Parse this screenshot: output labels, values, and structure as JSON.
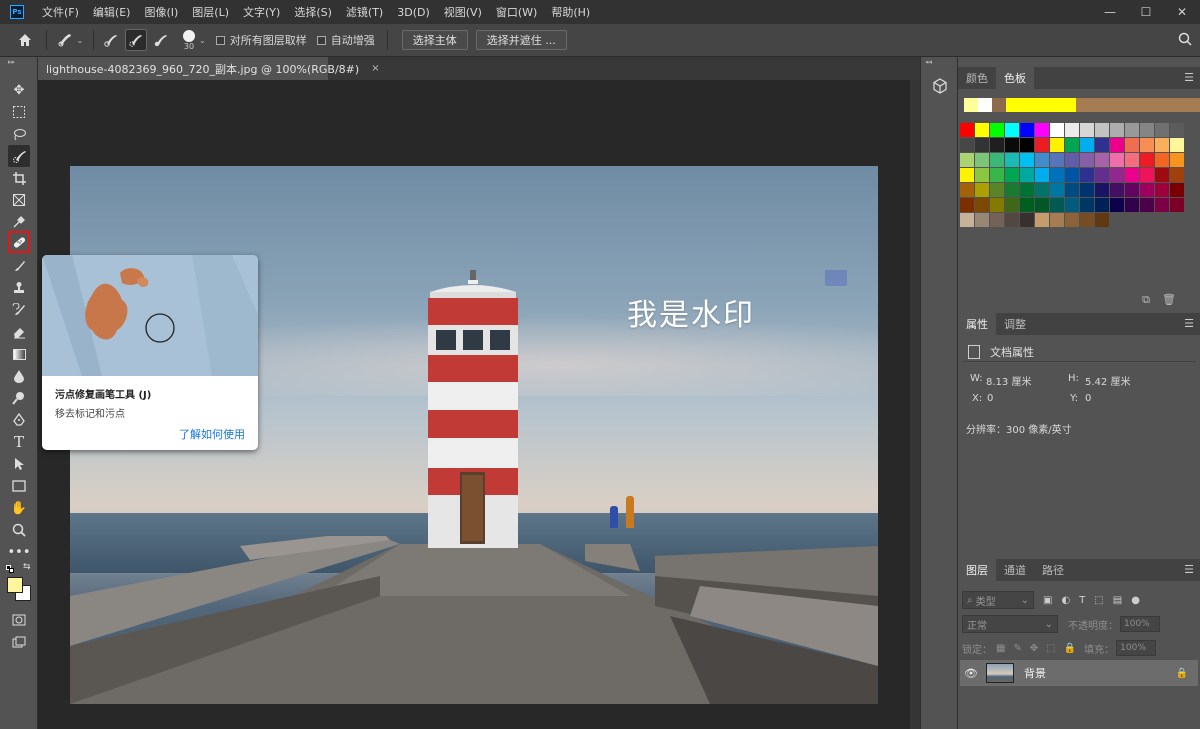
{
  "app": {
    "logo": "Ps"
  },
  "menu": [
    "文件(F)",
    "编辑(E)",
    "图像(I)",
    "图层(L)",
    "文字(Y)",
    "选择(S)",
    "滤镜(T)",
    "3D(D)",
    "视图(V)",
    "窗口(W)",
    "帮助(H)"
  ],
  "window_controls": {
    "minimize": "—",
    "maximize": "☐",
    "close": "✕"
  },
  "options": {
    "brush_size": "30",
    "sample_all_layers": "对所有图层取样",
    "auto_enhance": "自动增强",
    "select_subject": "选择主体",
    "select_and_mask": "选择并遮住 ..."
  },
  "document": {
    "tab_title": "lighthouse-4082369_960_720_副本.jpg @ 100%(RGB/8#)",
    "close": "×"
  },
  "image": {
    "watermark": "我是水印"
  },
  "tooltip": {
    "title": "污点修复画笔工具 (J)",
    "description": "移去标记和污点",
    "link": "了解如何使用"
  },
  "swatches_panel": {
    "tabs": [
      "颜色",
      "色板"
    ],
    "active_tab": 1,
    "recent": [
      "#ffff99",
      "#ffffff",
      "#8c6a4a",
      "#ffff00",
      "#ffff00",
      "#ffff00",
      "#ffff00",
      "#ffff00",
      "#a67c52",
      "#a67c52",
      "#a67c52",
      "#a67c52",
      "#a67c52",
      "#a67c52",
      "#a67c52",
      "#a67c52",
      "#a67c52",
      "#a67c52"
    ],
    "grid": [
      "#ff0000",
      "#ffff00",
      "#00ff00",
      "#00ffff",
      "#0000ff",
      "#ff00ff",
      "#ffffff",
      "#ebebeb",
      "#d6d6d6",
      "#c2c2c2",
      "#adadad",
      "#999999",
      "#858585",
      "#707070",
      "#5c5c5c",
      "#474747",
      "#333333",
      "#1f1f1f",
      "#0a0a0a",
      "#000000",
      "#ed1c24",
      "#fff200",
      "#00a651",
      "#00aeef",
      "#2e3192",
      "#ec008c",
      "#f26c4f",
      "#f68e56",
      "#fbaf5d",
      "#fff799",
      "#acd373",
      "#7cc576",
      "#3bb878",
      "#1abbb4",
      "#00bff3",
      "#438ccb",
      "#5574b9",
      "#605ca8",
      "#855fa8",
      "#a863a8",
      "#f06eaa",
      "#f26d7d",
      "#ed1c24",
      "#f26522",
      "#f7941d",
      "#fff200",
      "#8dc73f",
      "#39b54a",
      "#00a651",
      "#00a99d",
      "#00aeef",
      "#0072bc",
      "#0054a6",
      "#2e3192",
      "#662d91",
      "#92278f",
      "#ec008c",
      "#ed145b",
      "#9e0b0f",
      "#a0410d",
      "#a36209",
      "#aba000",
      "#598527",
      "#197b30",
      "#007236",
      "#00746b",
      "#0076a3",
      "#004b80",
      "#003471",
      "#1b1464",
      "#440e62",
      "#630460",
      "#9e005d",
      "#9e0039",
      "#790000",
      "#7b2e00",
      "#7d4900",
      "#827b00",
      "#406618",
      "#005e20",
      "#005826",
      "#005952",
      "#005b7f",
      "#003663",
      "#002157",
      "#0d004c",
      "#32004b",
      "#4b0049",
      "#7b0046",
      "#7a0026",
      "#c7b299",
      "#998675",
      "#736357",
      "#534741",
      "#37302d",
      "#c69c6d",
      "#a67c52",
      "#8c6239",
      "#754c24",
      "#603913"
    ],
    "footer": [
      "⧉",
      "🗑"
    ]
  },
  "properties_panel": {
    "tabs": [
      "属性",
      "调整"
    ],
    "active_tab": 0,
    "doc_props": "文档属性",
    "width_label": "W:",
    "width_value": "8.13 厘米",
    "height_label": "H:",
    "height_value": "5.42 厘米",
    "x_label": "X:",
    "x_value": "0",
    "y_label": "Y:",
    "y_value": "0",
    "resolution": "分辨率：300 像素/英寸"
  },
  "layers_panel": {
    "tabs": [
      "图层",
      "通道",
      "路径"
    ],
    "active_tab": 0,
    "filter_type": "类型",
    "blend_mode": "正常",
    "opacity_label": "不透明度：",
    "opacity_value": "100%",
    "lock_label": "锁定：",
    "fill_label": "填充：",
    "fill_value": "100%",
    "layer_name": "背景"
  }
}
